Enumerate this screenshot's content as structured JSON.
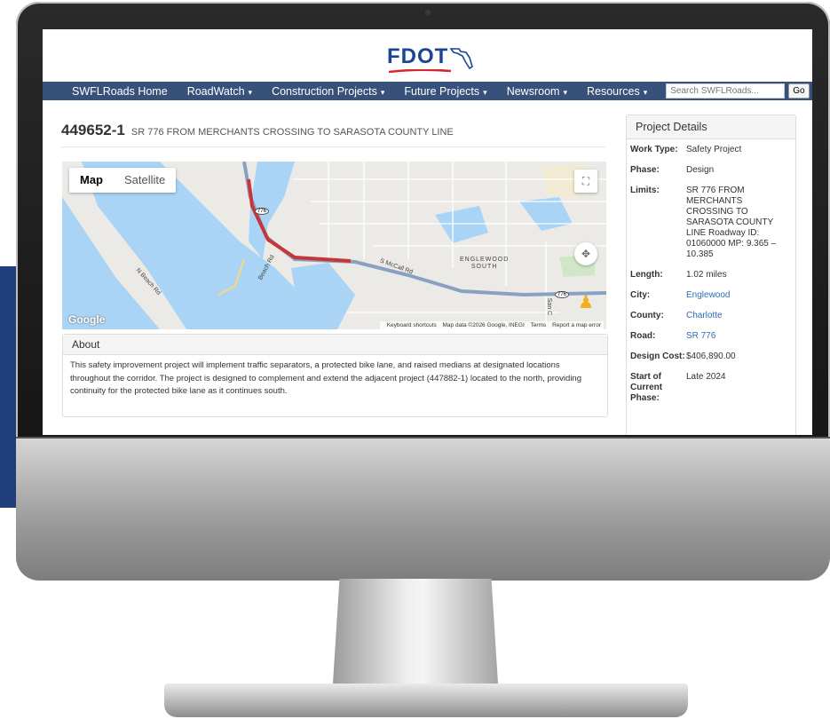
{
  "logo": {
    "text": "FDOT"
  },
  "nav": {
    "items": [
      {
        "label": "SWFLRoads Home",
        "dropdown": false
      },
      {
        "label": "RoadWatch",
        "dropdown": true
      },
      {
        "label": "Construction Projects",
        "dropdown": true
      },
      {
        "label": "Future Projects",
        "dropdown": true
      },
      {
        "label": "Newsroom",
        "dropdown": true
      },
      {
        "label": "Resources",
        "dropdown": true
      }
    ],
    "search_placeholder": "Search SWFLRoads...",
    "go_label": "Go",
    "caret": "▾"
  },
  "page": {
    "project_id": "449652-1",
    "project_title": "SR 776 FROM MERCHANTS CROSSING TO SARASOTA COUNTY LINE"
  },
  "map": {
    "type_map": "Map",
    "type_satellite": "Satellite",
    "label_englewood": "ENGLEWOOD",
    "label_south": "SOUTH",
    "label_mccall": "S McCall Rd",
    "label_beach": "Beach Rd",
    "label_nbeach": "N Beach Rd",
    "label_sanc": "San C",
    "shield_776a": "776",
    "shield_776b": "776",
    "google": "Google",
    "footer_shortcuts": "Keyboard shortcuts",
    "footer_data": "Map data ©2026 Google, INEGI",
    "footer_terms": "Terms",
    "footer_report": "Report a map error",
    "colors": {
      "water": "#a9d4f5",
      "land": "#ebeae6",
      "route": "#c5363a",
      "road": "#8aa0c2"
    }
  },
  "about": {
    "heading": "About",
    "body": "This safety improvement project will implement traffic separators, a protected bike lane, and raised medians at designated locations throughout the corridor. The project is designed to complement and extend the adjacent project (447882-1) located to the north, providing continuity for the protected bike lane as it continues south."
  },
  "details": {
    "heading": "Project Details",
    "rows": [
      {
        "key": "Work Type:",
        "value": "Safety Project",
        "link": false
      },
      {
        "key": "Phase:",
        "value": "Design",
        "link": false
      },
      {
        "key": "Limits:",
        "value": "SR 776 FROM MERCHANTS CROSSING TO SARASOTA COUNTY LINE Roadway ID: 01060000 MP: 9.365 – 10.385",
        "link": false
      },
      {
        "key": "Length:",
        "value": "1.02 miles",
        "link": false
      },
      {
        "key": "City:",
        "value": "Englewood",
        "link": true
      },
      {
        "key": "County:",
        "value": "Charlotte",
        "link": true
      },
      {
        "key": "Road:",
        "value": "SR 776",
        "link": true
      },
      {
        "key": "Design Cost:",
        "value": "$406,890.00",
        "link": false
      },
      {
        "key": "Start of Current Phase:",
        "value": "Late 2024",
        "link": false
      }
    ]
  }
}
